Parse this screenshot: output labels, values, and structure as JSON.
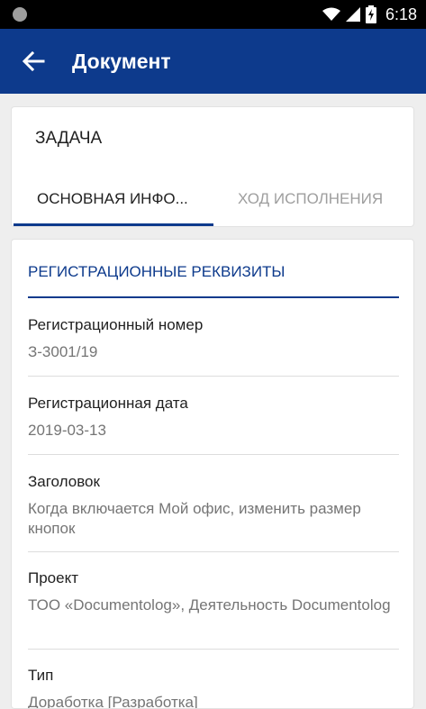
{
  "status_bar": {
    "time": "6:18",
    "icons": [
      "notification-dot-icon",
      "wifi-icon",
      "signal-icon",
      "battery-charging-icon"
    ]
  },
  "app_bar": {
    "title": "Документ",
    "back_icon": "arrow-left-icon",
    "color": "#0d3a8c"
  },
  "header_card": {
    "title": "ЗАДАЧА",
    "tabs": [
      {
        "label": "ОСНОВНАЯ ИНФО...",
        "selected": true
      },
      {
        "label": "ХОД ИСПОЛНЕНИЯ",
        "selected": false
      }
    ]
  },
  "details": {
    "section_title": "РЕГИСТРАЦИОННЫЕ РЕКВИЗИТЫ",
    "fields": [
      {
        "label": "Регистрационный номер",
        "value": "З-3001/19"
      },
      {
        "label": "Регистрационная дата",
        "value": "2019-03-13"
      },
      {
        "label": "Заголовок",
        "value": "Когда включается Мой офис, изменить размер кнопок"
      },
      {
        "label": "Проект",
        "value": "ТОО «Documentolog», Деятельность Documentolog"
      },
      {
        "label": "Тип",
        "value": "Доработка [Разработка]"
      }
    ]
  }
}
